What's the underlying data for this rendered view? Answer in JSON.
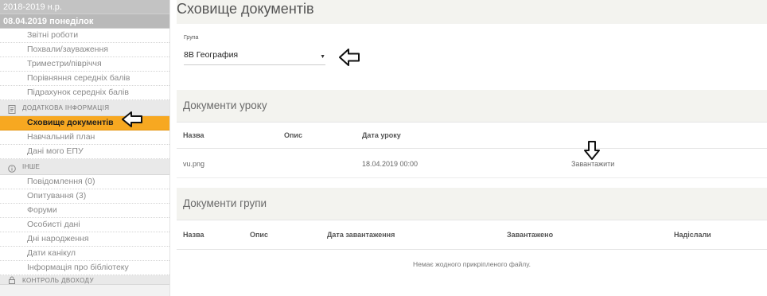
{
  "sidebar": {
    "year": "2018-2019 н.р.",
    "date": "08.04.2019 понеділок",
    "items_top": [
      "Звітні роботи",
      "Похвали/зауваження",
      "Триместри/півріччя",
      "Порівняння середніх балів",
      "Підрахунок середніх балів"
    ],
    "section_additional": "ДОДАТКОВА ІНФОРМАЦІЯ",
    "items_additional": [
      "Сховище документів",
      "Навчальний план",
      "Дані мого ЕПУ"
    ],
    "section_other": "ІНШЕ",
    "items_other": [
      "Повідомлення (0)",
      "Опитування (3)",
      "Форуми",
      "Особисті дані",
      "Дні народження",
      "Дати канікул",
      "Інформація про бібліотеку"
    ],
    "section_cut": "КОНТРОЛЬ ДВОХОДУ"
  },
  "main": {
    "title": "Сховище документів",
    "group_label": "Група",
    "group_value": "8В География",
    "lesson_docs": {
      "title": "Документи уроку",
      "columns": [
        "Назва",
        "Опис",
        "Дата уроку"
      ],
      "rows": [
        {
          "name": "vu.png",
          "description": "",
          "date": "18.04.2019 00:00",
          "action": "Завантажити"
        }
      ]
    },
    "group_docs": {
      "title": "Документи групи",
      "columns": [
        "Назва",
        "Опис",
        "Дата завантаження",
        "Завантажено",
        "Надіслали"
      ],
      "empty": "Немає жодного прикріпленого файлу."
    }
  },
  "colors": {
    "active": "#f7a821",
    "panel": "#f3f3ef"
  },
  "icons": [
    "document-icon",
    "info-icon",
    "lock-icon",
    "arrow-left-icon",
    "arrow-down-icon",
    "chevron-down-icon"
  ]
}
